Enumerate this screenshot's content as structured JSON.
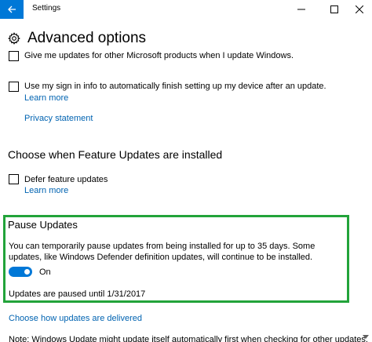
{
  "titlebar": {
    "app_title": "Settings"
  },
  "page": {
    "title": "Advanced options"
  },
  "options": {
    "other_products": {
      "label": "Give me updates for other Microsoft products when I update Windows.",
      "checked": false
    },
    "sign_in": {
      "label": "Use my sign in info to automatically finish setting up my device after an update.",
      "checked": false,
      "learn_more": "Learn more"
    },
    "privacy_link": "Privacy statement"
  },
  "feature_updates": {
    "heading": "Choose when Feature Updates are installed",
    "defer_label": "Defer feature updates",
    "defer_checked": false,
    "learn_more": "Learn more"
  },
  "pause_updates": {
    "heading": "Pause Updates",
    "description": "You can temporarily pause updates from being installed for up to 35 days. Some updates, like Windows Defender definition updates, will continue to be installed.",
    "toggle_state": "On",
    "toggle_on": true,
    "status": "Updates are paused until 1/31/2017"
  },
  "links": {
    "delivery": "Choose how updates are delivered"
  },
  "footnote": "Note: Windows Update might update itself automatically first when checking for other updates.",
  "colors": {
    "accent": "#0078d7",
    "link": "#0063b1",
    "highlight_border": "#22a33a"
  },
  "icons": {
    "back": "back-arrow-icon",
    "settings": "gear-icon",
    "minimize": "minimize-icon",
    "maximize": "maximize-icon",
    "close": "close-icon"
  }
}
